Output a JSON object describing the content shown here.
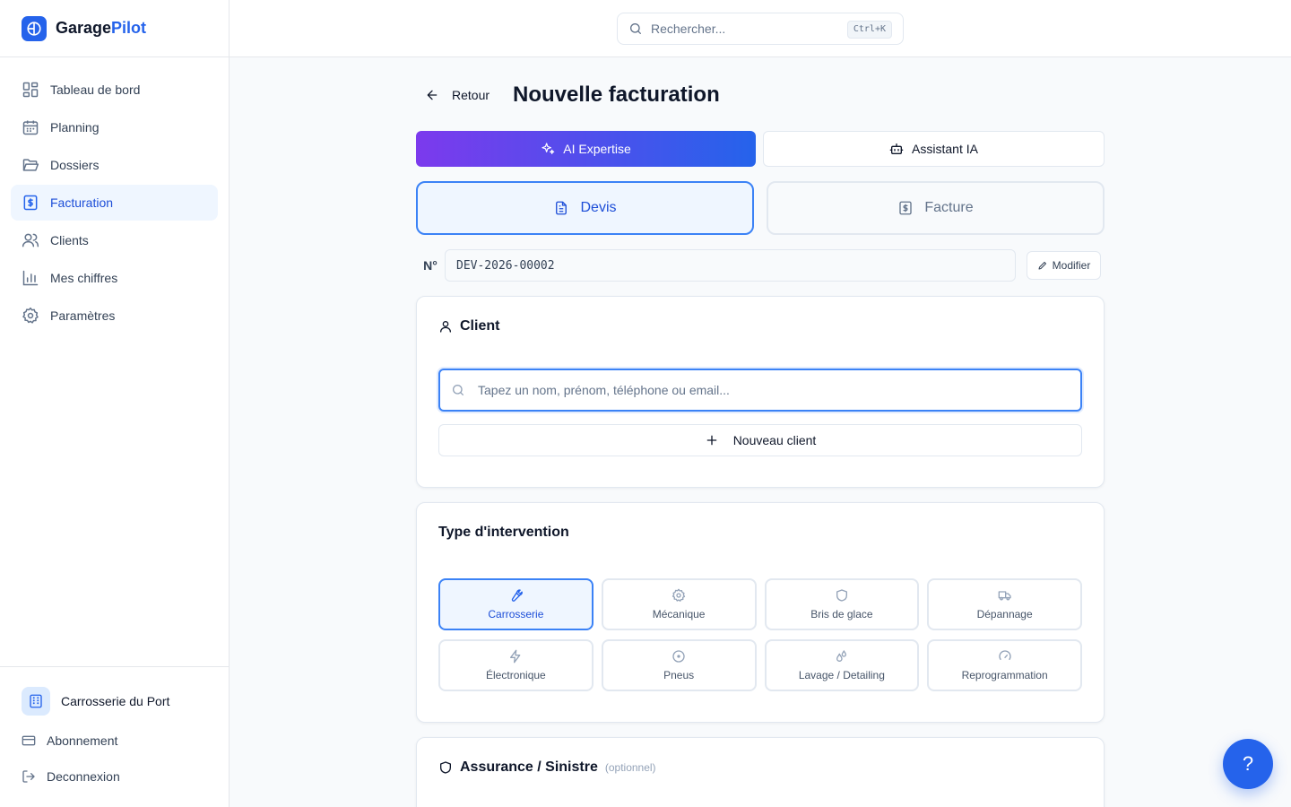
{
  "brand": {
    "name_part1": "Garage",
    "name_part2": "Pilot"
  },
  "sidebar": {
    "items": [
      {
        "label": "Tableau de bord",
        "icon": "dashboard-icon"
      },
      {
        "label": "Planning",
        "icon": "calendar-icon"
      },
      {
        "label": "Dossiers",
        "icon": "folder-icon"
      },
      {
        "label": "Facturation",
        "icon": "invoice-icon",
        "active": true
      },
      {
        "label": "Clients",
        "icon": "users-icon"
      },
      {
        "label": "Mes chiffres",
        "icon": "bar-chart-icon"
      },
      {
        "label": "Paramètres",
        "icon": "gear-icon"
      }
    ],
    "garage_name": "Carrosserie du Port",
    "subscription_label": "Abonnement",
    "logout_label": "Deconnexion"
  },
  "topbar": {
    "search_placeholder": "Rechercher...",
    "shortcut": "Ctrl+K"
  },
  "header": {
    "back_label": "Retour",
    "title": "Nouvelle facturation"
  },
  "ai": {
    "expertise_label": "AI Expertise",
    "assistant_label": "Assistant IA"
  },
  "doc_type": {
    "quote_label": "Devis",
    "invoice_label": "Facture",
    "selected": "Devis"
  },
  "number": {
    "label": "N°",
    "value": "DEV-2026-00002",
    "edit_label": "Modifier"
  },
  "client": {
    "title": "Client",
    "search_placeholder": "Tapez un nom, prénom, téléphone ou email...",
    "new_client_label": "Nouveau client"
  },
  "intervention": {
    "title": "Type d'intervention",
    "types": [
      {
        "label": "Carrosserie",
        "icon": "wrench-icon",
        "selected": true
      },
      {
        "label": "Mécanique",
        "icon": "gear-icon"
      },
      {
        "label": "Bris de glace",
        "icon": "shield-icon"
      },
      {
        "label": "Dépannage",
        "icon": "truck-icon"
      },
      {
        "label": "Électronique",
        "icon": "lightning-icon"
      },
      {
        "label": "Pneus",
        "icon": "tire-icon"
      },
      {
        "label": "Lavage / Detailing",
        "icon": "droplets-icon"
      },
      {
        "label": "Reprogrammation",
        "icon": "gauge-icon"
      }
    ]
  },
  "insurance": {
    "title": "Assurance / Sinistre",
    "optional_label": "(optionnel)"
  },
  "help": {
    "label": "?"
  },
  "colors": {
    "primary": "#2563eb",
    "accent_purple": "#7c3aed",
    "active_bg": "#eff6ff"
  }
}
